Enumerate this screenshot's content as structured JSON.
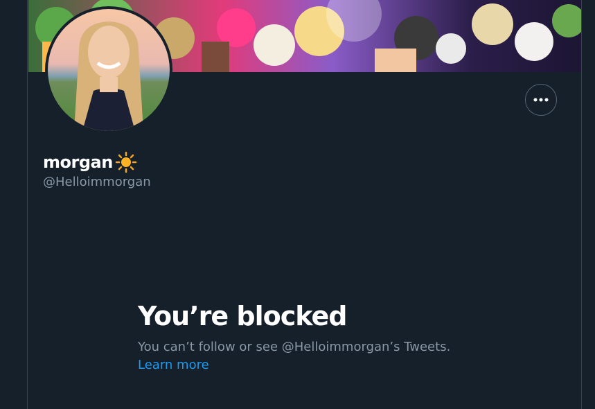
{
  "profile": {
    "display_name": "morgan",
    "name_emoji_icon": "sun-icon",
    "handle": "@Helloimmorgan"
  },
  "header": {
    "more_button_icon": "more-dots-icon"
  },
  "blocked": {
    "title": "You’re blocked",
    "description": "You can’t follow or see @Helloimmorgan’s Tweets.",
    "learn_more": "Learn more"
  },
  "colors": {
    "background": "#15202b",
    "text_primary": "#ffffff",
    "text_secondary": "#8b98a5",
    "link": "#1d9bf0",
    "border": "#38444d"
  }
}
